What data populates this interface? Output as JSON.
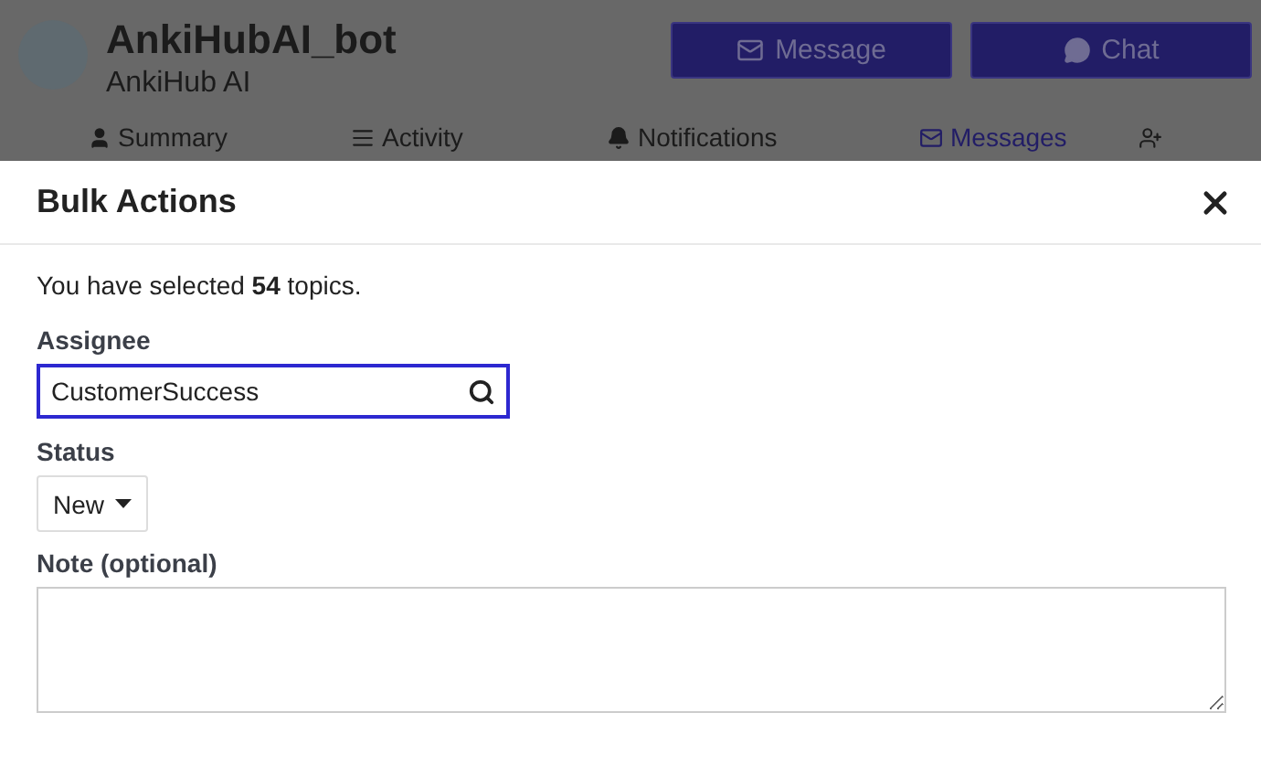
{
  "profile": {
    "name": "AnkiHubAI_bot",
    "subtitle": "AnkiHub AI"
  },
  "header_buttons": [
    {
      "label": "Message",
      "kind": "message"
    },
    {
      "label": "Chat",
      "kind": "chat"
    }
  ],
  "nav_tabs": [
    {
      "label": "Summary",
      "kind": "user",
      "selected": false
    },
    {
      "label": "Activity",
      "kind": "list",
      "selected": false
    },
    {
      "label": "Notifications",
      "kind": "bell",
      "selected": false
    },
    {
      "label": "Messages",
      "kind": "mail",
      "selected": true
    }
  ],
  "modal": {
    "title": "Bulk Actions",
    "summary": "You have selected **54** topics.",
    "fields": [
      {
        "label": "Assignee",
        "kind": "search",
        "value": "CustomerSuccess",
        "focused": true
      },
      {
        "label": "Status",
        "kind": "select",
        "value": "New",
        "focused": false
      },
      {
        "label": "Note (optional)",
        "kind": "textarea",
        "focused": false
      }
    ]
  }
}
